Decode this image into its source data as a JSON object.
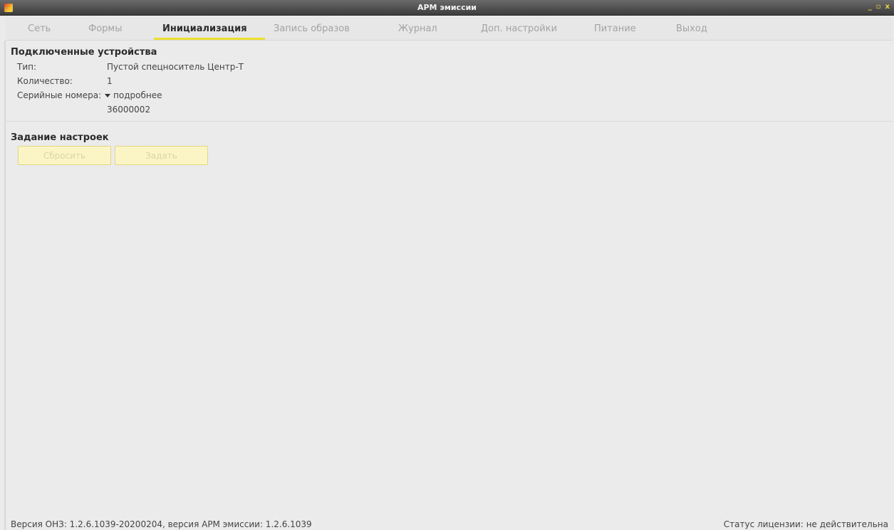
{
  "window": {
    "title": "АРМ эмиссии",
    "controls": [
      "_",
      "▫",
      "x"
    ]
  },
  "tabs": [
    {
      "label": "Сеть",
      "active": false
    },
    {
      "label": "Формы",
      "active": false
    },
    {
      "label": "Инициализация",
      "active": true
    },
    {
      "label": "Запись образов",
      "active": false
    },
    {
      "label": "Журнал",
      "active": false
    },
    {
      "label": "Доп. настройки",
      "active": false
    },
    {
      "label": "Питание",
      "active": false
    },
    {
      "label": "Выход",
      "active": false
    }
  ],
  "devices": {
    "title": "Подключенные устройства",
    "type_label": "Тип:",
    "type_value": "Пустой спецноситель Центр-Т",
    "count_label": "Количество:",
    "count_value": "1",
    "serials_label": "Серийные номера:",
    "more_label": "подробнее",
    "serials": [
      "36000002"
    ]
  },
  "settings": {
    "title": "Задание настроек",
    "reset_label": "Сбросить",
    "apply_label": "Задать"
  },
  "footer": {
    "version": "Версия ОНЗ: 1.2.6.1039-20200204, версия АРМ эмиссии: 1.2.6.1039",
    "license": "Статус лицензии: не действительна"
  },
  "colors": {
    "accent": "#ece030",
    "button_bg": "#fbf5c6",
    "titlebar": "#4a4a4a"
  },
  "icons": {
    "app": "app-logo-icon",
    "expander": "chevron-down-icon"
  }
}
